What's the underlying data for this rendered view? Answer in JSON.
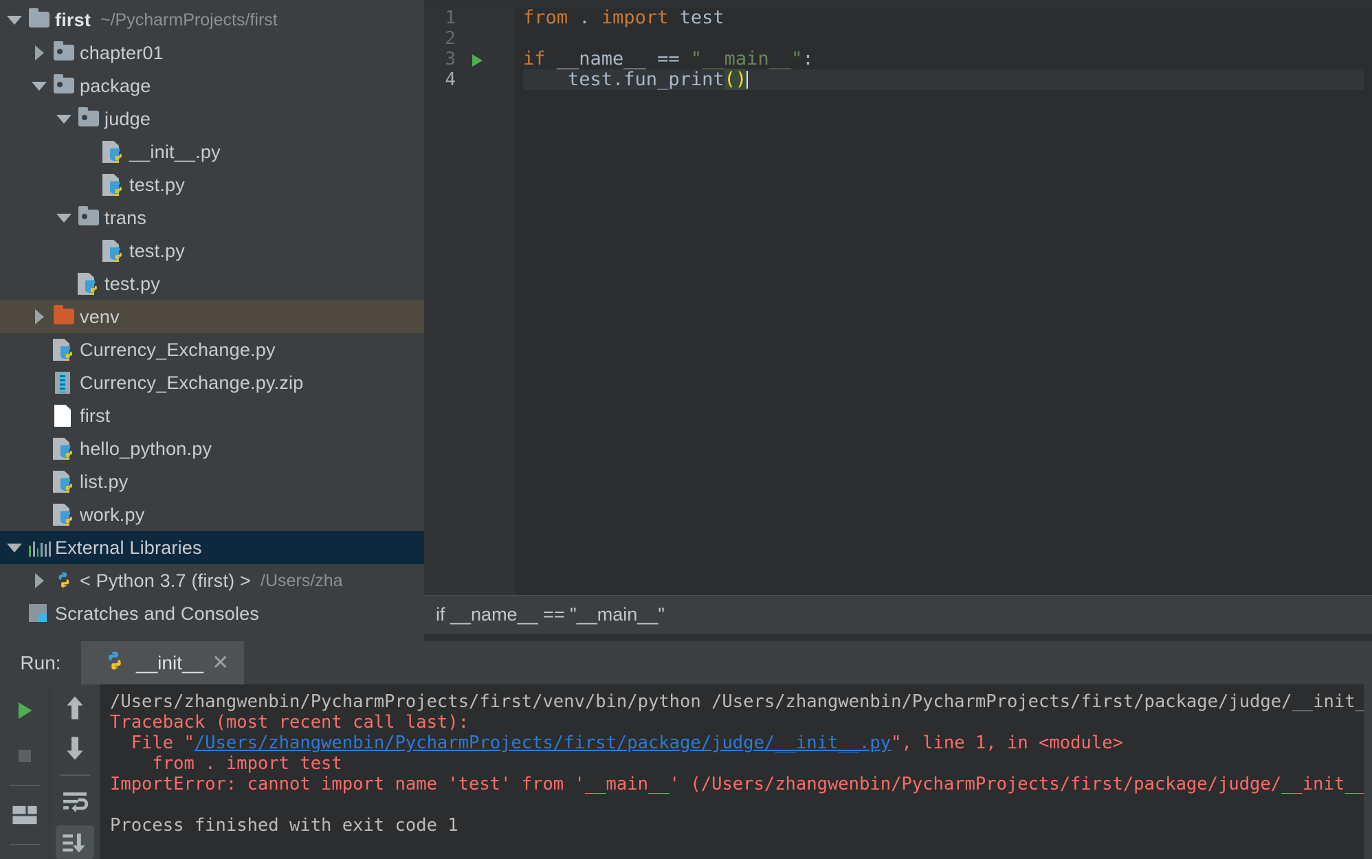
{
  "window": {
    "theme_accent": "#4fb3d0",
    "sidebar_bg": "#3c3f41",
    "editor_bg": "#2b2d2e",
    "selection_olive": "#4e4a40",
    "selection_blue": "#0d293e"
  },
  "project_tree": {
    "items": [
      {
        "label": "first",
        "path": "~/PycharmProjects/first",
        "twisty": "down",
        "icon": "folder-icon",
        "depth": 0,
        "bold": true,
        "selected": "none"
      },
      {
        "label": "chapter01",
        "path": "",
        "twisty": "right",
        "icon": "package-folder-icon",
        "depth": 1,
        "bold": false,
        "selected": "none"
      },
      {
        "label": "package",
        "path": "",
        "twisty": "down",
        "icon": "package-folder-icon",
        "depth": 1,
        "bold": false,
        "selected": "none"
      },
      {
        "label": "judge",
        "path": "",
        "twisty": "down",
        "icon": "package-folder-icon",
        "depth": 2,
        "bold": false,
        "selected": "none"
      },
      {
        "label": "__init__.py",
        "path": "",
        "twisty": "none",
        "icon": "python-file-icon",
        "depth": 3,
        "bold": false,
        "selected": "none"
      },
      {
        "label": "test.py",
        "path": "",
        "twisty": "none",
        "icon": "python-file-icon",
        "depth": 3,
        "bold": false,
        "selected": "none"
      },
      {
        "label": "trans",
        "path": "",
        "twisty": "down",
        "icon": "package-folder-icon",
        "depth": 2,
        "bold": false,
        "selected": "none"
      },
      {
        "label": "test.py",
        "path": "",
        "twisty": "none",
        "icon": "python-file-icon",
        "depth": 3,
        "bold": false,
        "selected": "none"
      },
      {
        "label": "test.py",
        "path": "",
        "twisty": "none",
        "icon": "python-file-icon",
        "depth": 2,
        "bold": false,
        "selected": "none"
      },
      {
        "label": "venv",
        "path": "",
        "twisty": "right",
        "icon": "excluded-folder-icon",
        "depth": 1,
        "bold": false,
        "selected": "olive"
      },
      {
        "label": "Currency_Exchange.py",
        "path": "",
        "twisty": "none",
        "icon": "python-file-icon",
        "depth": 1,
        "bold": false,
        "selected": "none"
      },
      {
        "label": "Currency_Exchange.py.zip",
        "path": "",
        "twisty": "none",
        "icon": "zip-file-icon",
        "depth": 1,
        "bold": false,
        "selected": "none"
      },
      {
        "label": "first",
        "path": "",
        "twisty": "none",
        "icon": "file-icon",
        "depth": 1,
        "bold": false,
        "selected": "none"
      },
      {
        "label": "hello_python.py",
        "path": "",
        "twisty": "none",
        "icon": "python-file-icon",
        "depth": 1,
        "bold": false,
        "selected": "none"
      },
      {
        "label": "list.py",
        "path": "",
        "twisty": "none",
        "icon": "python-file-icon",
        "depth": 1,
        "bold": false,
        "selected": "none"
      },
      {
        "label": "work.py",
        "path": "",
        "twisty": "none",
        "icon": "python-file-icon",
        "depth": 1,
        "bold": false,
        "selected": "none"
      },
      {
        "label": "External Libraries",
        "path": "",
        "twisty": "down",
        "icon": "libraries-icon",
        "depth": 0,
        "bold": false,
        "selected": "blue"
      },
      {
        "label": "< Python 3.7 (first) >",
        "path": "/Users/zha",
        "twisty": "right",
        "icon": "python-interpreter-icon",
        "depth": 1,
        "bold": false,
        "selected": "none"
      },
      {
        "label": "Scratches and Consoles",
        "path": "",
        "twisty": "none",
        "icon": "scratches-icon",
        "depth": 0,
        "bold": false,
        "selected": "none"
      }
    ]
  },
  "editor": {
    "lines": [
      {
        "num": "1",
        "run_marker": false,
        "current": false,
        "tokens": [
          {
            "t": "from",
            "c": "kw"
          },
          {
            "t": " ",
            "c": "plain"
          },
          {
            "t": ".",
            "c": "plain"
          },
          {
            "t": " ",
            "c": "plain"
          },
          {
            "t": "import",
            "c": "kw"
          },
          {
            "t": " test",
            "c": "plain"
          }
        ]
      },
      {
        "num": "2",
        "run_marker": false,
        "current": false,
        "tokens": []
      },
      {
        "num": "3",
        "run_marker": true,
        "current": false,
        "tokens": [
          {
            "t": "if",
            "c": "kw"
          },
          {
            "t": " __name__ == ",
            "c": "plain"
          },
          {
            "t": "\"__main__\"",
            "c": "str"
          },
          {
            "t": ":",
            "c": "plain"
          }
        ]
      },
      {
        "num": "4",
        "run_marker": false,
        "current": true,
        "tokens": [
          {
            "t": "    test.fun_print",
            "c": "plain"
          },
          {
            "t": "()",
            "c": "paren-hl"
          }
        ]
      }
    ],
    "breadcrumb": "if __name__ == \"__main__\""
  },
  "run_panel": {
    "label": "Run:",
    "tab_name": "__init__",
    "tab_icon": "python-icon",
    "close_icon": "close-icon",
    "toolbar_left": [
      {
        "name": "rerun-button",
        "icon": "play-icon"
      },
      {
        "name": "stop-button",
        "icon": "stop-icon"
      },
      {
        "name": "restore-layout-button",
        "icon": "layout-icon"
      }
    ],
    "toolbar_right": [
      {
        "name": "up-stack-trace-button",
        "icon": "arrow-up-icon"
      },
      {
        "name": "down-stack-trace-button",
        "icon": "arrow-down-icon"
      },
      {
        "name": "soft-wrap-button",
        "icon": "soft-wrap-icon"
      },
      {
        "name": "scroll-to-end-button",
        "icon": "scroll-to-end-icon"
      }
    ],
    "console_lines": [
      {
        "segments": [
          {
            "t": "/Users/zhangwenbin/PycharmProjects/first/venv/bin/python /Users/zhangwenbin/PycharmProjects/first/package/judge/__init__.py",
            "c": "c-white"
          }
        ]
      },
      {
        "segments": [
          {
            "t": "Traceback (most recent call last):",
            "c": "c-red"
          }
        ]
      },
      {
        "segments": [
          {
            "t": "  File \"",
            "c": "c-red"
          },
          {
            "t": "/Users/zhangwenbin/PycharmProjects/first/package/judge/__init__.py",
            "c": "c-link"
          },
          {
            "t": "\", line 1, in <module>",
            "c": "c-red"
          }
        ]
      },
      {
        "segments": [
          {
            "t": "    from . import test",
            "c": "c-red"
          }
        ]
      },
      {
        "segments": [
          {
            "t": "ImportError: cannot import name 'test' from '__main__' (/Users/zhangwenbin/PycharmProjects/first/package/judge/__init__.py)",
            "c": "c-red"
          }
        ]
      },
      {
        "segments": [
          {
            "t": "",
            "c": "c-white"
          }
        ]
      },
      {
        "segments": [
          {
            "t": "Process finished with exit code 1",
            "c": "c-white"
          }
        ]
      }
    ]
  }
}
